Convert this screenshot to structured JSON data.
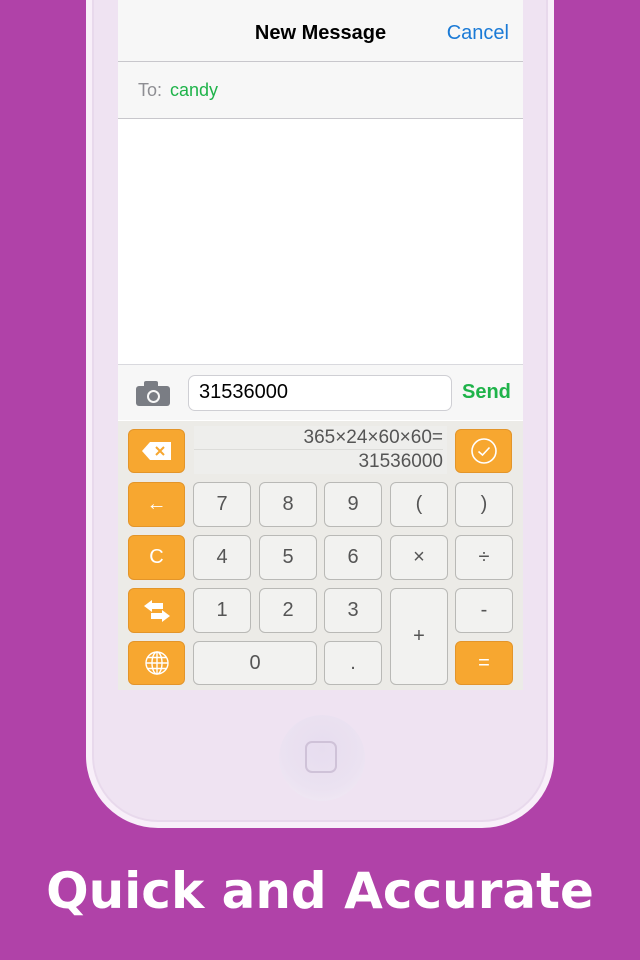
{
  "navbar": {
    "title": "New Message",
    "cancel_label": "Cancel"
  },
  "recipient": {
    "label": "To:",
    "value": "candy"
  },
  "compose": {
    "message_value": "31536000",
    "send_label": "Send",
    "camera_icon": "camera-icon"
  },
  "calculator": {
    "display": {
      "expression": "365×24×60×60=",
      "result": "31536000"
    },
    "keys": {
      "backspace": "backspace-icon",
      "confirm": "check-circle-icon",
      "left": "←",
      "clear": "C",
      "switch": "swap-arrows-icon",
      "globe": "globe-icon",
      "k7": "7",
      "k8": "8",
      "k9": "9",
      "lparen": "(",
      "rparen": ")",
      "k4": "4",
      "k5": "5",
      "k6": "6",
      "mul": "×",
      "div": "÷",
      "k1": "1",
      "k2": "2",
      "k3": "3",
      "plus": "+",
      "minus": "-",
      "k0": "0",
      "dot": ".",
      "equals": "="
    }
  },
  "tagline": "Quick and Accurate",
  "colors": {
    "background": "#b042a8",
    "accent_orange": "#f7a730",
    "send_green": "#1fb34a",
    "link_blue": "#1a7ad6"
  }
}
